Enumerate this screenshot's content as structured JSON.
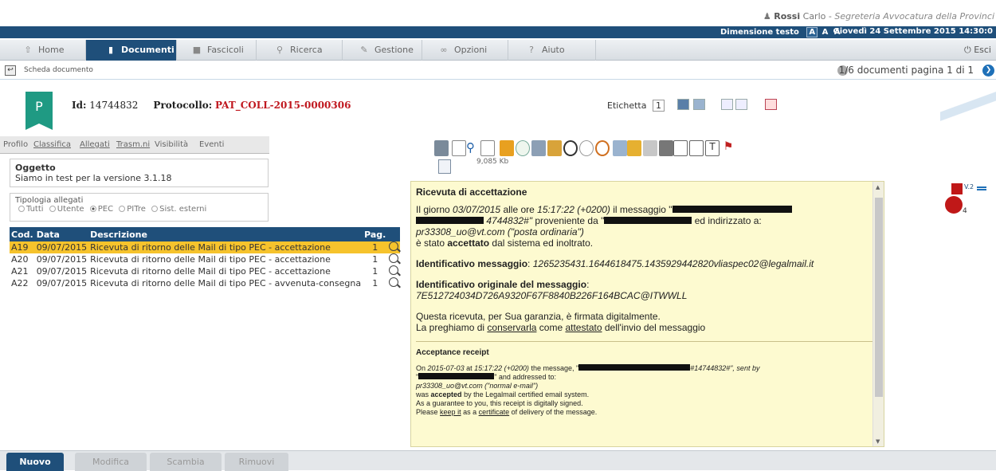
{
  "user": {
    "surname": "Rossi",
    "name": "Carlo",
    "role": "Segreteria Avvocatura della Provinci"
  },
  "topbar": {
    "text_size_label": "Dimensione testo",
    "size_options": [
      "A",
      "A",
      "A"
    ],
    "datetime": "Giovedì 24 Settembre 2015 14:30:0"
  },
  "nav": {
    "tabs": [
      {
        "label": "Home",
        "icon": "home-icon"
      },
      {
        "label": "Documenti",
        "icon": "document-icon",
        "active": true
      },
      {
        "label": "Fascicoli",
        "icon": "folder-icon"
      },
      {
        "label": "Ricerca",
        "icon": "search-icon"
      },
      {
        "label": "Gestione",
        "icon": "pencil-icon"
      },
      {
        "label": "Opzioni",
        "icon": "options-icon"
      },
      {
        "label": "Aiuto",
        "icon": "help-icon"
      }
    ],
    "logout": "Esci"
  },
  "scheda": {
    "label": "Scheda documento",
    "pager": "1/6 documenti pagina 1 di 1"
  },
  "doc": {
    "badge": "P",
    "id_label": "Id:",
    "id_value": "14744832",
    "protocol_label": "Protocollo:",
    "protocol_value": "PAT_COLL-2015-0000306",
    "etichetta_label": "Etichetta",
    "etichetta_value": "1"
  },
  "subtabs": [
    "Profilo",
    "Classifica",
    "Allegati",
    "Trasm.ni",
    "Visibilità",
    "Eventi"
  ],
  "oggetto": {
    "title": "Oggetto",
    "value": "Siamo in test per la versione 3.1.18"
  },
  "tipologia": {
    "title": "Tipologia allegati",
    "options": [
      "Tutti",
      "Utente",
      "PEC",
      "PITre",
      "Sist. esterni"
    ],
    "selected": "PEC"
  },
  "table": {
    "headers": [
      "Cod.",
      "Data",
      "Descrizione",
      "Pag."
    ],
    "rows": [
      {
        "cod": "A19",
        "data": "09/07/2015",
        "desc": "Ricevuta di ritorno delle Mail di tipo PEC - accettazione",
        "pag": "1"
      },
      {
        "cod": "A20",
        "data": "09/07/2015",
        "desc": "Ricevuta di ritorno delle Mail di tipo PEC - accettazione",
        "pag": "1"
      },
      {
        "cod": "A21",
        "data": "09/07/2015",
        "desc": "Ricevuta di ritorno delle Mail di tipo PEC - accettazione",
        "pag": "1"
      },
      {
        "cod": "A22",
        "data": "09/07/2015",
        "desc": "Ricevuta di ritorno delle Mail di tipo PEC - avvenuta-consegna",
        "pag": "1"
      }
    ]
  },
  "file_size": "9,085 Kb",
  "viewer": {
    "title": "Ricevuta di accettazione",
    "p1_a": "Il giorno",
    "p1_date": "03/07/2015",
    "p1_b": "alle ore",
    "p1_time": "15:17:22 (+0200)",
    "p1_c": "il messaggio \"",
    "p1_d": "4744832#\"",
    "p1_e": "proveniente da \"",
    "p1_f": "ed indirizzato a:",
    "p1_addr": "pr33308_uo@vt.com (\"posta ordinaria\")",
    "p1_g": "è stato",
    "p1_accepted": "accettato",
    "p1_h": "dal sistema ed inoltrato.",
    "id_msg_label": "Identificativo messaggio",
    "id_msg_value": "1265235431.1644618475.1435929442820vliaspec02@legalmail.it",
    "id_orig_label": "Identificativo originale del messaggio",
    "id_orig_value": "7E512724034D726A9320F67F8840B226F164BCAC@ITWWLL",
    "p3_a": "Questa ricevuta, per Sua garanzia, è firmata digitalmente.",
    "p3_b": "La preghiamo di",
    "p3_conservarla": "conservarla",
    "p3_c": "come",
    "p3_attestato": "attestato",
    "p3_d": "dell'invio del messaggio",
    "en_title": "Acceptance receipt",
    "en_a": "On",
    "en_date": "2015-07-03",
    "en_b": "at",
    "en_time": "15:17:22 (+0200)",
    "en_c": "the message, \"",
    "en_d": "#14744832#\", sent by",
    "en_e": "\" and addressed to:",
    "en_addr": "pr33308_uo@vt.com (\"normal e-mail\")",
    "en_f": "was",
    "en_accepted": "accepted",
    "en_g": "by the Legalmail certified email system.",
    "en_h": "As a guarantee to you, this receipt is digitally signed.",
    "en_i": "Please",
    "en_keep": "keep it",
    "en_j": "as a",
    "en_certificate": "certificate",
    "en_k": "of delivery of the message."
  },
  "version_label": "V.2",
  "version_count": "4",
  "bottom": {
    "buttons": [
      "Nuovo",
      "Modifica",
      "Scambia",
      "Rimuovi"
    ]
  },
  "colors": {
    "primary": "#1f4f7a",
    "selected_row": "#f6c32c",
    "badge": "#1f9a83",
    "protocol": "#c0181f",
    "viewer_bg": "#fdfad0"
  }
}
